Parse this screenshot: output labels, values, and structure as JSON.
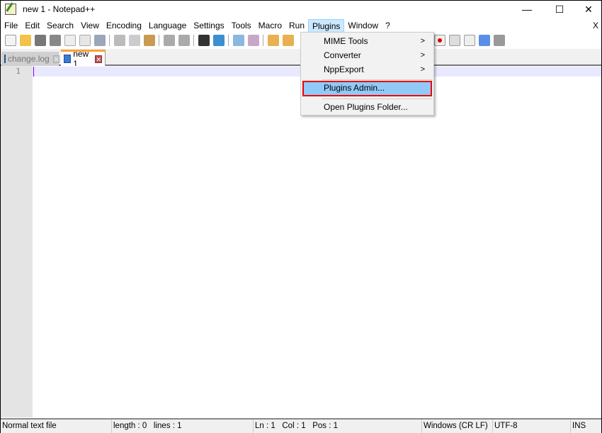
{
  "window": {
    "title": "new 1 - Notepad++",
    "minimize": "—",
    "maximize": "☐",
    "close": "✕"
  },
  "menubar": {
    "items": [
      "File",
      "Edit",
      "Search",
      "View",
      "Encoding",
      "Language",
      "Settings",
      "Tools",
      "Macro",
      "Run",
      "Plugins",
      "Window",
      "?"
    ],
    "close": "X"
  },
  "tabs": [
    {
      "label": "change.log",
      "close": "✕"
    },
    {
      "label": "new 1",
      "close": "✕"
    }
  ],
  "editor": {
    "line_number": "1",
    "content": ""
  },
  "plugins_menu": {
    "items": [
      {
        "label": "MIME Tools",
        "submenu": ">"
      },
      {
        "label": "Converter",
        "submenu": ">"
      },
      {
        "label": "NppExport",
        "submenu": ">"
      },
      {
        "label": "Plugins Admin..."
      },
      {
        "label": "Open Plugins Folder..."
      }
    ]
  },
  "statusbar": {
    "file_type": "Normal text file",
    "length": "length : 0",
    "lines": "lines : 1",
    "ln": "Ln : 1",
    "col": "Col : 1",
    "pos": "Pos : 1",
    "eol": "Windows (CR LF)",
    "encoding": "UTF-8",
    "mode": "INS"
  },
  "colors": {
    "highlight": "#91c9f7",
    "outline": "#e00000",
    "tab_accent": "#f9a13a"
  }
}
